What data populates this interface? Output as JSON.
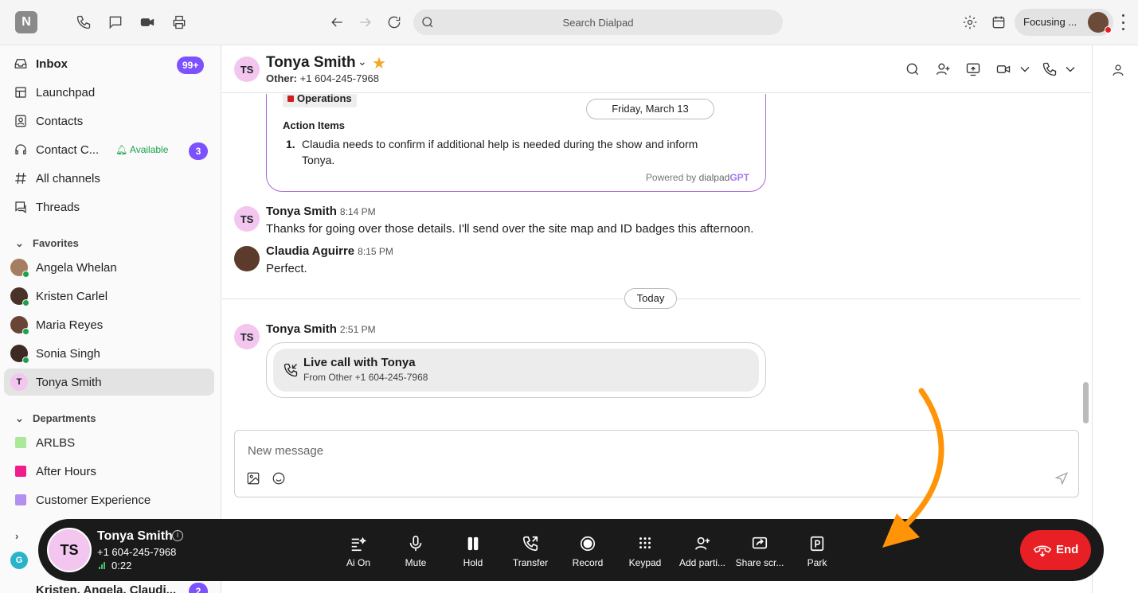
{
  "app": {
    "logo_text": "N",
    "search_placeholder": "Search Dialpad",
    "status_label": "Focusing ..."
  },
  "sidebar": {
    "nav": [
      {
        "label": "Inbox",
        "badge": "99+"
      },
      {
        "label": "Launchpad"
      },
      {
        "label": "Contacts"
      },
      {
        "label": "Contact C...",
        "status": "Available",
        "badge": "3"
      },
      {
        "label": "All channels"
      },
      {
        "label": "Threads"
      }
    ],
    "favorites_header": "Favorites",
    "favorites": [
      "Angela Whelan",
      "Kristen Carlel",
      "Maria Reyes",
      "Sonia Singh",
      "Tonya Smith"
    ],
    "tonya_initial": "T",
    "departments_header": "Departments",
    "departments": [
      {
        "label": "ARLBS",
        "color": "#a8e99a"
      },
      {
        "label": "After Hours",
        "color": "#ef1c8b"
      },
      {
        "label": "Customer Experience",
        "color": "#b28ff0"
      }
    ],
    "group_initial": "G",
    "group_chat": {
      "label": "Kristen, Angela, Claudi...",
      "badge": "2"
    }
  },
  "conversation": {
    "initials": "TS",
    "name": "Tonya Smith",
    "sub_label": "Other:",
    "sub_number": "+1 604-245-7968"
  },
  "ai_recap": {
    "tag": "Operations",
    "date": "Friday, March 13",
    "action_header": "Action Items",
    "items": [
      {
        "num": "1.",
        "text": "Claudia needs to confirm if additional help is needed during the show and inform Tonya."
      }
    ],
    "powered_by": "Powered by",
    "brand_a": "dialpad",
    "brand_b": "GPT"
  },
  "messages": [
    {
      "author": "Tonya Smith",
      "time": "8:14 PM",
      "text": "Thanks for going over those details. I'll send over the site map and ID badges this afternoon."
    },
    {
      "author": "Claudia Aguirre",
      "time": "8:15 PM",
      "text": "Perfect."
    }
  ],
  "today_divider": "Today",
  "live_msg": {
    "author": "Tonya Smith",
    "time": "2:51 PM",
    "title": "Live call with Tonya",
    "subtitle": "From Other +1 604-245-7968"
  },
  "composer": {
    "placeholder": "New message"
  },
  "callbar": {
    "initials": "TS",
    "name": "Tonya Smith",
    "number": "+1 604-245-7968",
    "duration": "0:22",
    "buttons": [
      "Ai On",
      "Mute",
      "Hold",
      "Transfer",
      "Record",
      "Keypad",
      "Add parti...",
      "Share scr...",
      "Park"
    ],
    "end_label": "End"
  },
  "colors": {
    "accent": "#7c52ff",
    "end": "#e81f25",
    "annotation": "#ff9408"
  }
}
